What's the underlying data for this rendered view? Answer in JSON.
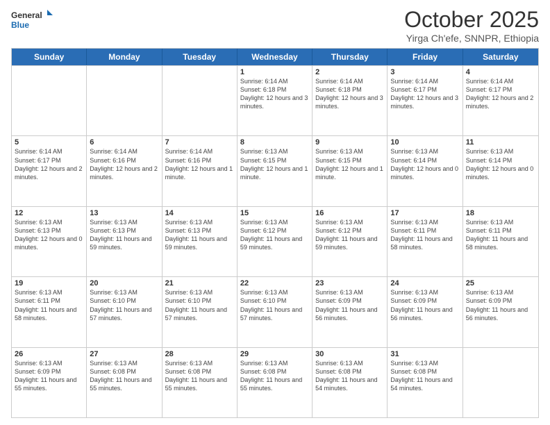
{
  "logo": {
    "line1": "General",
    "line2": "Blue"
  },
  "title": "October 2025",
  "location": "Yirga Ch'efe, SNNPR, Ethiopia",
  "days": [
    "Sunday",
    "Monday",
    "Tuesday",
    "Wednesday",
    "Thursday",
    "Friday",
    "Saturday"
  ],
  "weeks": [
    [
      {
        "day": "",
        "info": ""
      },
      {
        "day": "",
        "info": ""
      },
      {
        "day": "",
        "info": ""
      },
      {
        "day": "1",
        "info": "Sunrise: 6:14 AM\nSunset: 6:18 PM\nDaylight: 12 hours and 3 minutes."
      },
      {
        "day": "2",
        "info": "Sunrise: 6:14 AM\nSunset: 6:18 PM\nDaylight: 12 hours and 3 minutes."
      },
      {
        "day": "3",
        "info": "Sunrise: 6:14 AM\nSunset: 6:17 PM\nDaylight: 12 hours and 3 minutes."
      },
      {
        "day": "4",
        "info": "Sunrise: 6:14 AM\nSunset: 6:17 PM\nDaylight: 12 hours and 2 minutes."
      }
    ],
    [
      {
        "day": "5",
        "info": "Sunrise: 6:14 AM\nSunset: 6:17 PM\nDaylight: 12 hours and 2 minutes."
      },
      {
        "day": "6",
        "info": "Sunrise: 6:14 AM\nSunset: 6:16 PM\nDaylight: 12 hours and 2 minutes."
      },
      {
        "day": "7",
        "info": "Sunrise: 6:14 AM\nSunset: 6:16 PM\nDaylight: 12 hours and 1 minute."
      },
      {
        "day": "8",
        "info": "Sunrise: 6:13 AM\nSunset: 6:15 PM\nDaylight: 12 hours and 1 minute."
      },
      {
        "day": "9",
        "info": "Sunrise: 6:13 AM\nSunset: 6:15 PM\nDaylight: 12 hours and 1 minute."
      },
      {
        "day": "10",
        "info": "Sunrise: 6:13 AM\nSunset: 6:14 PM\nDaylight: 12 hours and 0 minutes."
      },
      {
        "day": "11",
        "info": "Sunrise: 6:13 AM\nSunset: 6:14 PM\nDaylight: 12 hours and 0 minutes."
      }
    ],
    [
      {
        "day": "12",
        "info": "Sunrise: 6:13 AM\nSunset: 6:13 PM\nDaylight: 12 hours and 0 minutes."
      },
      {
        "day": "13",
        "info": "Sunrise: 6:13 AM\nSunset: 6:13 PM\nDaylight: 11 hours and 59 minutes."
      },
      {
        "day": "14",
        "info": "Sunrise: 6:13 AM\nSunset: 6:13 PM\nDaylight: 11 hours and 59 minutes."
      },
      {
        "day": "15",
        "info": "Sunrise: 6:13 AM\nSunset: 6:12 PM\nDaylight: 11 hours and 59 minutes."
      },
      {
        "day": "16",
        "info": "Sunrise: 6:13 AM\nSunset: 6:12 PM\nDaylight: 11 hours and 59 minutes."
      },
      {
        "day": "17",
        "info": "Sunrise: 6:13 AM\nSunset: 6:11 PM\nDaylight: 11 hours and 58 minutes."
      },
      {
        "day": "18",
        "info": "Sunrise: 6:13 AM\nSunset: 6:11 PM\nDaylight: 11 hours and 58 minutes."
      }
    ],
    [
      {
        "day": "19",
        "info": "Sunrise: 6:13 AM\nSunset: 6:11 PM\nDaylight: 11 hours and 58 minutes."
      },
      {
        "day": "20",
        "info": "Sunrise: 6:13 AM\nSunset: 6:10 PM\nDaylight: 11 hours and 57 minutes."
      },
      {
        "day": "21",
        "info": "Sunrise: 6:13 AM\nSunset: 6:10 PM\nDaylight: 11 hours and 57 minutes."
      },
      {
        "day": "22",
        "info": "Sunrise: 6:13 AM\nSunset: 6:10 PM\nDaylight: 11 hours and 57 minutes."
      },
      {
        "day": "23",
        "info": "Sunrise: 6:13 AM\nSunset: 6:09 PM\nDaylight: 11 hours and 56 minutes."
      },
      {
        "day": "24",
        "info": "Sunrise: 6:13 AM\nSunset: 6:09 PM\nDaylight: 11 hours and 56 minutes."
      },
      {
        "day": "25",
        "info": "Sunrise: 6:13 AM\nSunset: 6:09 PM\nDaylight: 11 hours and 56 minutes."
      }
    ],
    [
      {
        "day": "26",
        "info": "Sunrise: 6:13 AM\nSunset: 6:09 PM\nDaylight: 11 hours and 55 minutes."
      },
      {
        "day": "27",
        "info": "Sunrise: 6:13 AM\nSunset: 6:08 PM\nDaylight: 11 hours and 55 minutes."
      },
      {
        "day": "28",
        "info": "Sunrise: 6:13 AM\nSunset: 6:08 PM\nDaylight: 11 hours and 55 minutes."
      },
      {
        "day": "29",
        "info": "Sunrise: 6:13 AM\nSunset: 6:08 PM\nDaylight: 11 hours and 55 minutes."
      },
      {
        "day": "30",
        "info": "Sunrise: 6:13 AM\nSunset: 6:08 PM\nDaylight: 11 hours and 54 minutes."
      },
      {
        "day": "31",
        "info": "Sunrise: 6:13 AM\nSunset: 6:08 PM\nDaylight: 11 hours and 54 minutes."
      },
      {
        "day": "",
        "info": ""
      }
    ]
  ]
}
